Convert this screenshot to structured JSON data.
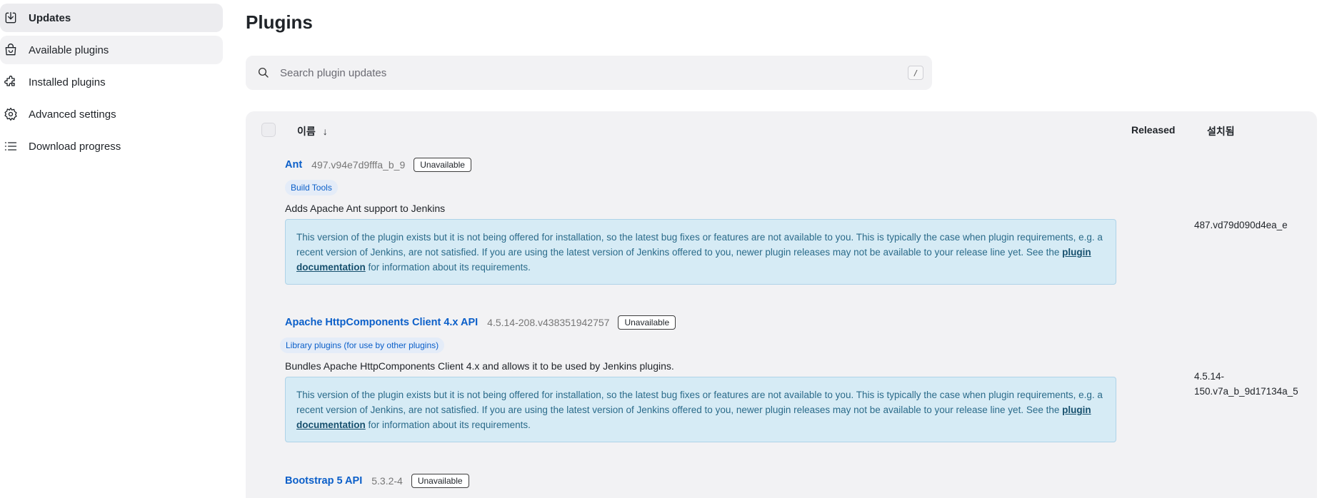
{
  "sidebar": {
    "items": [
      {
        "label": "Updates",
        "icon": "download-icon"
      },
      {
        "label": "Available plugins",
        "icon": "shopping-bag-icon"
      },
      {
        "label": "Installed plugins",
        "icon": "puzzle-icon"
      },
      {
        "label": "Advanced settings",
        "icon": "gear-icon"
      },
      {
        "label": "Download progress",
        "icon": "list-icon"
      }
    ]
  },
  "main": {
    "title": "Plugins",
    "search": {
      "placeholder": "Search plugin updates",
      "shortcut": "/"
    },
    "table": {
      "columns": {
        "name": "이름",
        "sort_arrow": "↓",
        "released": "Released",
        "installed": "설치됨"
      },
      "plugins": [
        {
          "name": "Ant",
          "version": "497.v94e7d9fffa_b_9",
          "status": "Unavailable",
          "category": "Build Tools",
          "description": "Adds Apache Ant support to Jenkins",
          "notice_before": "This version of the plugin exists but it is not being offered for installation, so the latest bug fixes or features are not available to you. This is typically the case when plugin requirements, e.g. a recent version of Jenkins, are not satisfied. If you are using the latest version of Jenkins offered to you, newer plugin releases may not be available to your release line yet. See the ",
          "notice_link": "plugin documentation",
          "notice_after": " for information about its requirements.",
          "installed": "487.vd79d090d4ea_e"
        },
        {
          "name": "Apache HttpComponents Client 4.x API",
          "version": "4.5.14-208.v438351942757",
          "status": "Unavailable",
          "category": "Library plugins (for use by other plugins)",
          "description": "Bundles Apache HttpComponents Client 4.x and allows it to be used by Jenkins plugins.",
          "notice_before": "This version of the plugin exists but it is not being offered for installation, so the latest bug fixes or features are not available to you. This is typically the case when plugin requirements, e.g. a recent version of Jenkins, are not satisfied. If you are using the latest version of Jenkins offered to you, newer plugin releases may not be available to your release line yet. See the ",
          "notice_link": "plugin documentation",
          "notice_after": " for information about its requirements.",
          "installed_line1": "4.5.14-",
          "installed_line2": "150.v7a_b_9d17134a_5"
        },
        {
          "name": "Bootstrap 5 API",
          "version": "5.3.2-4",
          "status": "Unavailable"
        }
      ]
    }
  }
}
